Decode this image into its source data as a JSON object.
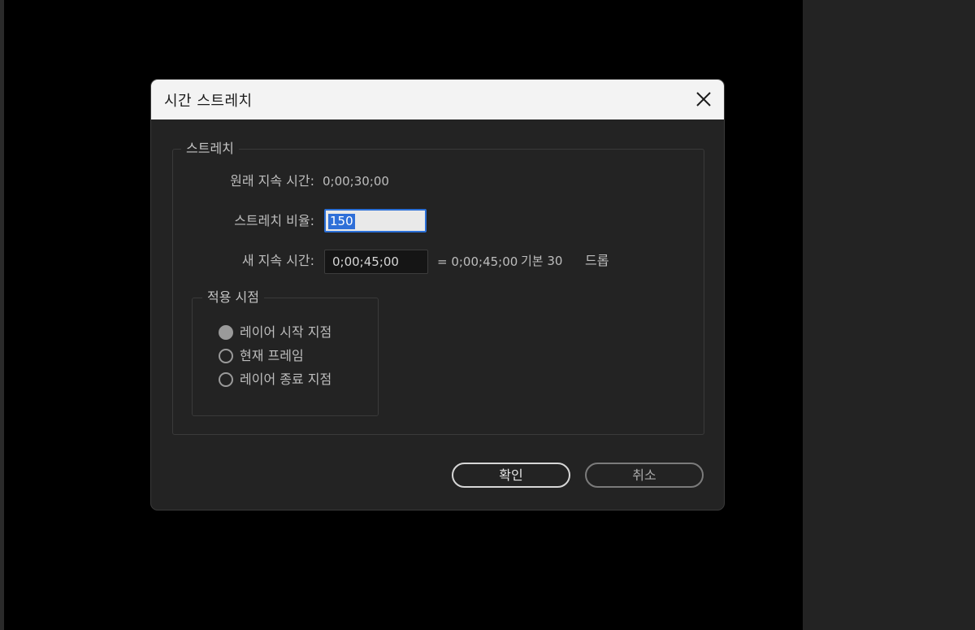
{
  "dialog": {
    "title": "시간 스트레치",
    "close_icon": "close-icon"
  },
  "stretch": {
    "legend": "스트레치",
    "original_label": "원래 지속 시간:",
    "original_value": "0;00;30;00",
    "ratio_label": "스트레치 비율:",
    "ratio_value": "150",
    "new_label": "새 지속 시간:",
    "new_value": "0;00;45;00",
    "new_equals": "= 0;00;45;00",
    "base_text": "기본 30",
    "drop_text": "드롭"
  },
  "apply": {
    "legend": "적용 시점",
    "options": [
      {
        "label": "레이어 시작 지점",
        "checked": true
      },
      {
        "label": "현재 프레임",
        "checked": false
      },
      {
        "label": "레이어 종료 지점",
        "checked": false
      }
    ]
  },
  "buttons": {
    "ok": "확인",
    "cancel": "취소"
  }
}
